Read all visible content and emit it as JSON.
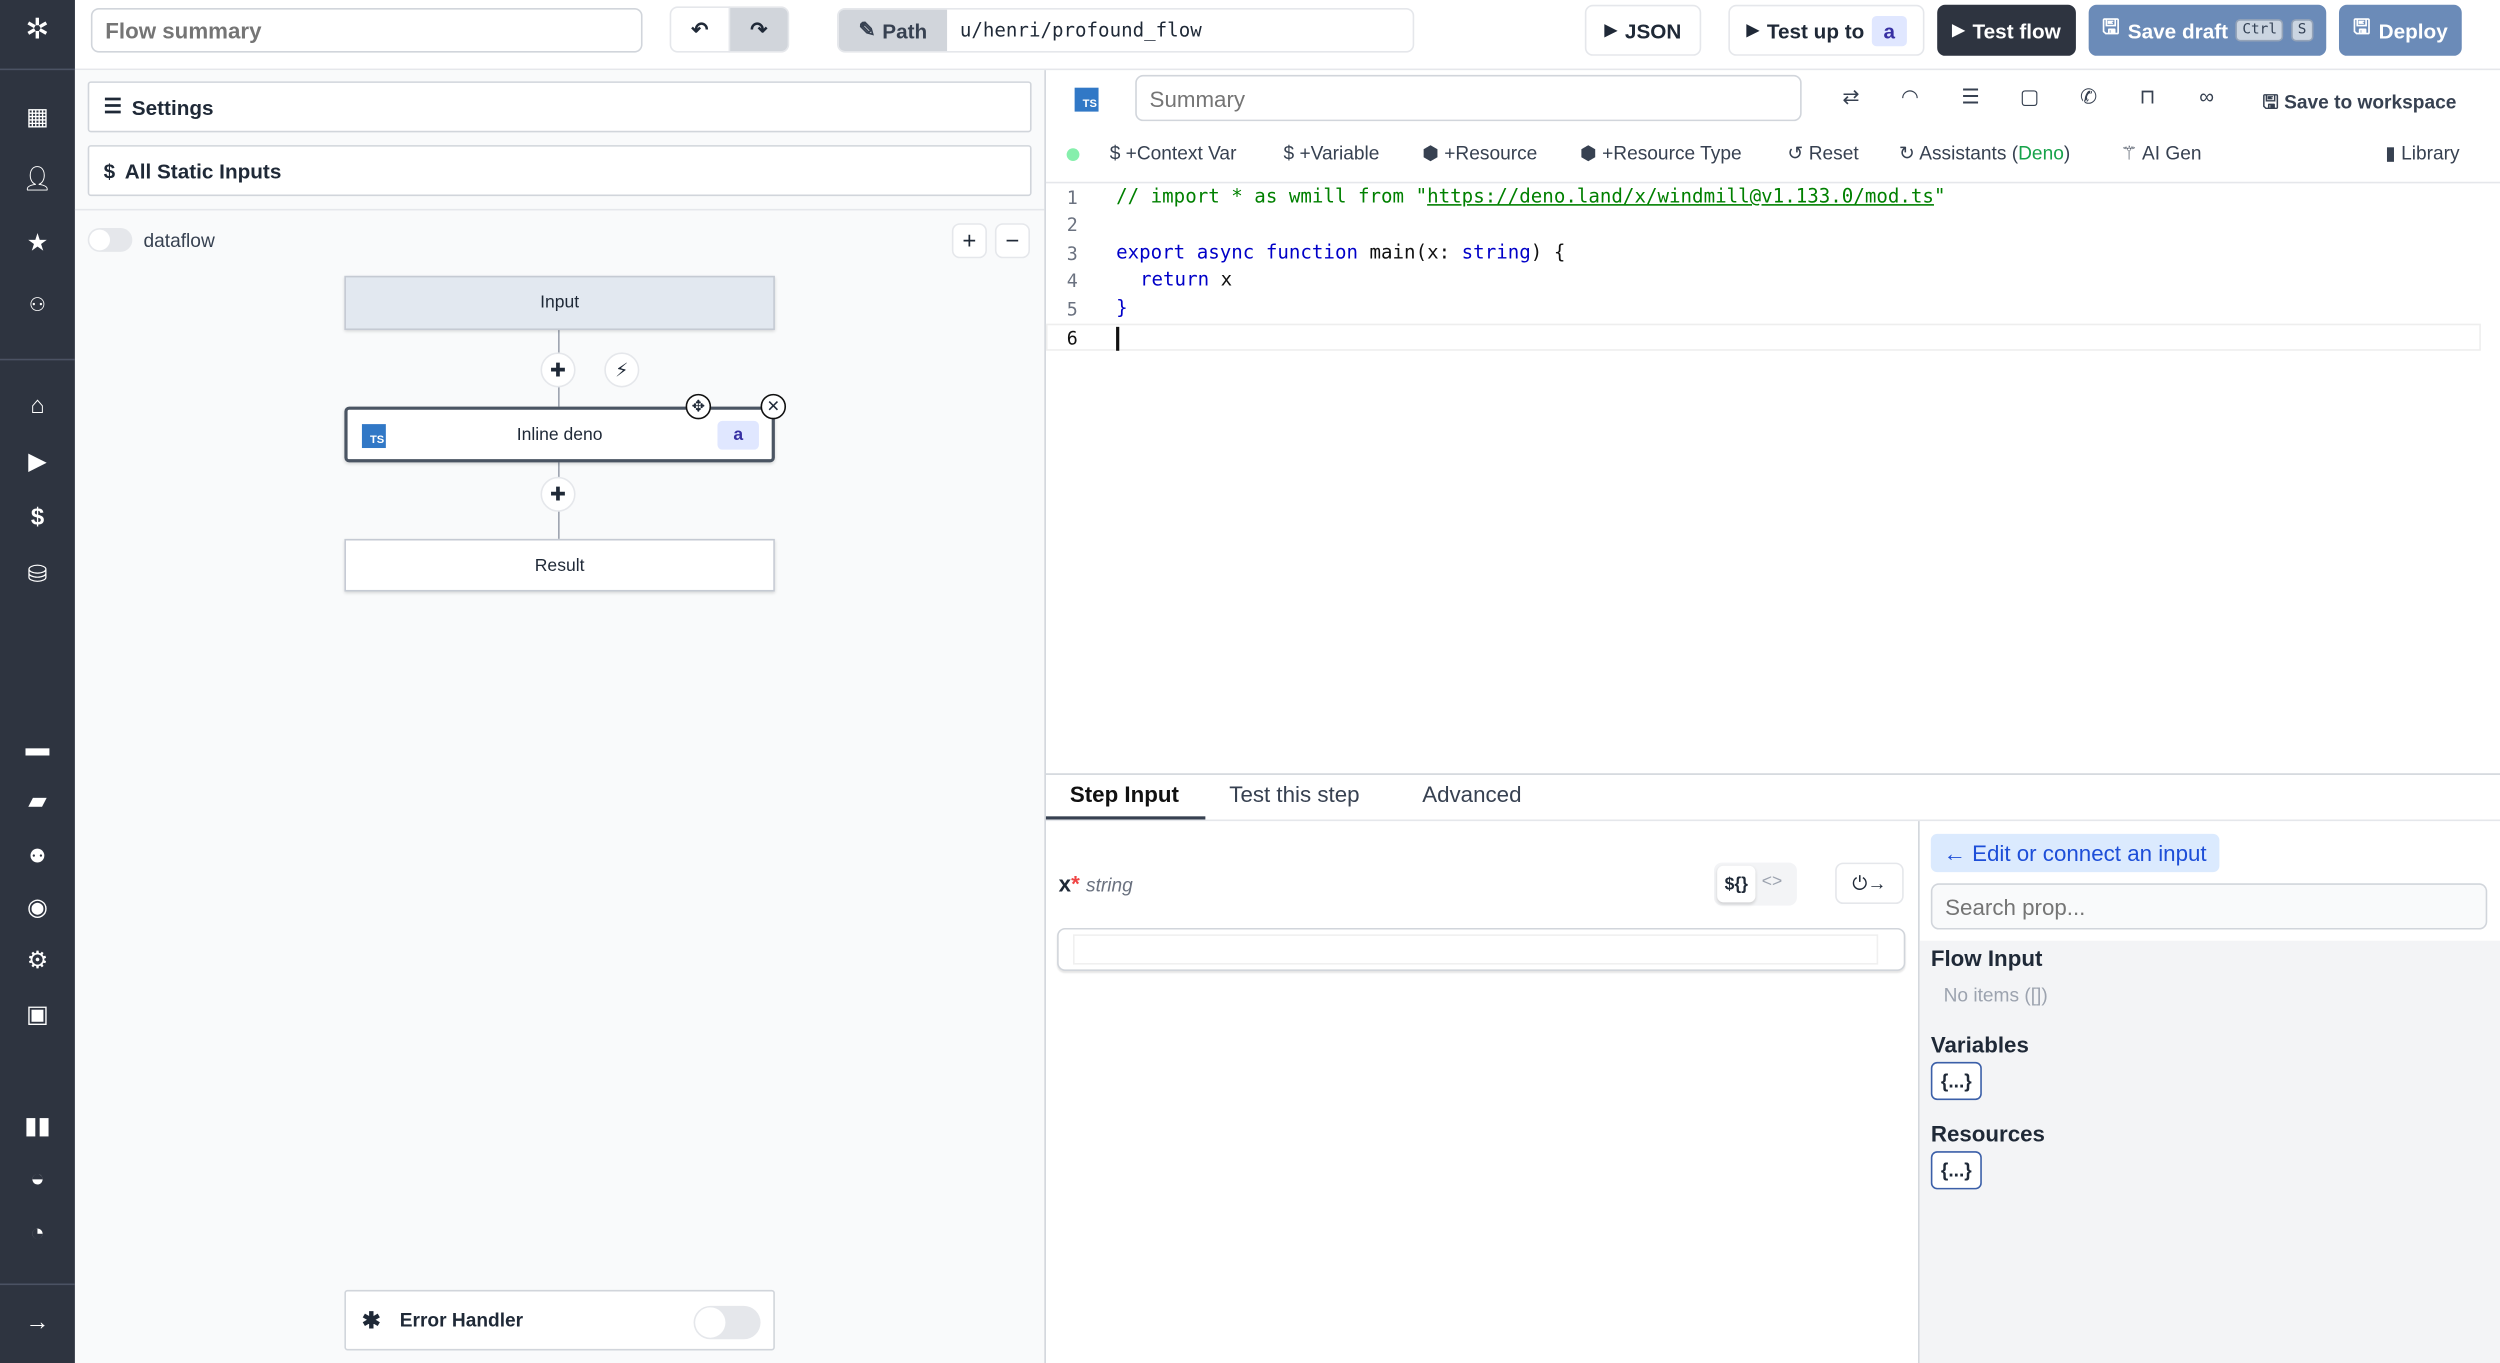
{
  "colors": {
    "sidebar": "#2e3440",
    "accent": "#6b8bb8",
    "dark_button": "#2e3440",
    "ts_badge": "#3178c6"
  },
  "sidebar": {
    "icons": [
      "windmill-logo",
      "building-icon",
      "user-icon",
      "star-icon",
      "users-icon",
      "home-icon",
      "play-icon",
      "dollar-icon",
      "cubes-icon",
      "calendar-icon",
      "folder-open-icon",
      "users-cog-icon",
      "eye-icon",
      "settings-icon",
      "bot-icon",
      "book-icon",
      "discord-icon",
      "github-icon",
      "expand-arrow-icon"
    ]
  },
  "header": {
    "summary_placeholder": "Flow summary",
    "path_label": "Path",
    "path_value": "u/henri/profound_flow",
    "json_label": "JSON",
    "test_up_to_label": "Test up to",
    "test_up_to_step": "a",
    "test_flow_label": "Test flow",
    "save_draft_label": "Save draft",
    "save_draft_keys": [
      "Ctrl",
      "S"
    ],
    "deploy_label": "Deploy"
  },
  "left": {
    "settings_label": "Settings",
    "static_inputs_label": "All Static Inputs",
    "dataflow_label": "dataflow",
    "dataflow_on": false,
    "zoom_in": "+",
    "zoom_out": "−",
    "nodes": {
      "input": "Input",
      "step": "Inline deno",
      "step_lang": "TS",
      "step_id": "a",
      "result": "Result"
    },
    "error_handler_label": "Error Handler",
    "error_handler_on": false
  },
  "editor": {
    "lang_badge": "TS",
    "summary_placeholder": "Summary",
    "save_workspace_label": "Save to workspace",
    "toolbar": {
      "context_var": "$ +Context Var",
      "variable": "$ +Variable",
      "resource": "+Resource",
      "resource_type": "+Resource Type",
      "reset": "Reset",
      "assistants": "Assistants (",
      "assistants_lang": "Deno",
      "assistants_close": ")",
      "ai_gen": "AI Gen",
      "library": "Library"
    },
    "lines": [
      "1",
      "2",
      "3",
      "4",
      "5",
      "6"
    ],
    "code": {
      "l1_comment": "// import * as wmill from \"",
      "l1_url": "https://deno.land/x/windmill@v1.133.0/mod.ts",
      "l1_end": "\"",
      "l3_kw": "export async function",
      "l3_rest": " main(x: ",
      "l3_type": "string",
      "l3_end": ") {",
      "l4_kw": "return",
      "l4_rest": " x",
      "l5": "}"
    }
  },
  "bottom": {
    "tabs": [
      "Step Input",
      "Test this step",
      "Advanced"
    ],
    "active_tab": "Step Input",
    "arg_name": "x",
    "arg_required": "*",
    "arg_type": "string",
    "expr_toggle": "${}",
    "code_toggle": "<>",
    "connect_button": "⏻→",
    "edit_connect_label": "← Edit or connect an input",
    "search_placeholder": "Search prop...",
    "flow_input_title": "Flow Input",
    "flow_input_empty": "No items ([])",
    "variables_title": "Variables",
    "resources_title": "Resources",
    "brace_label": "{...}"
  }
}
